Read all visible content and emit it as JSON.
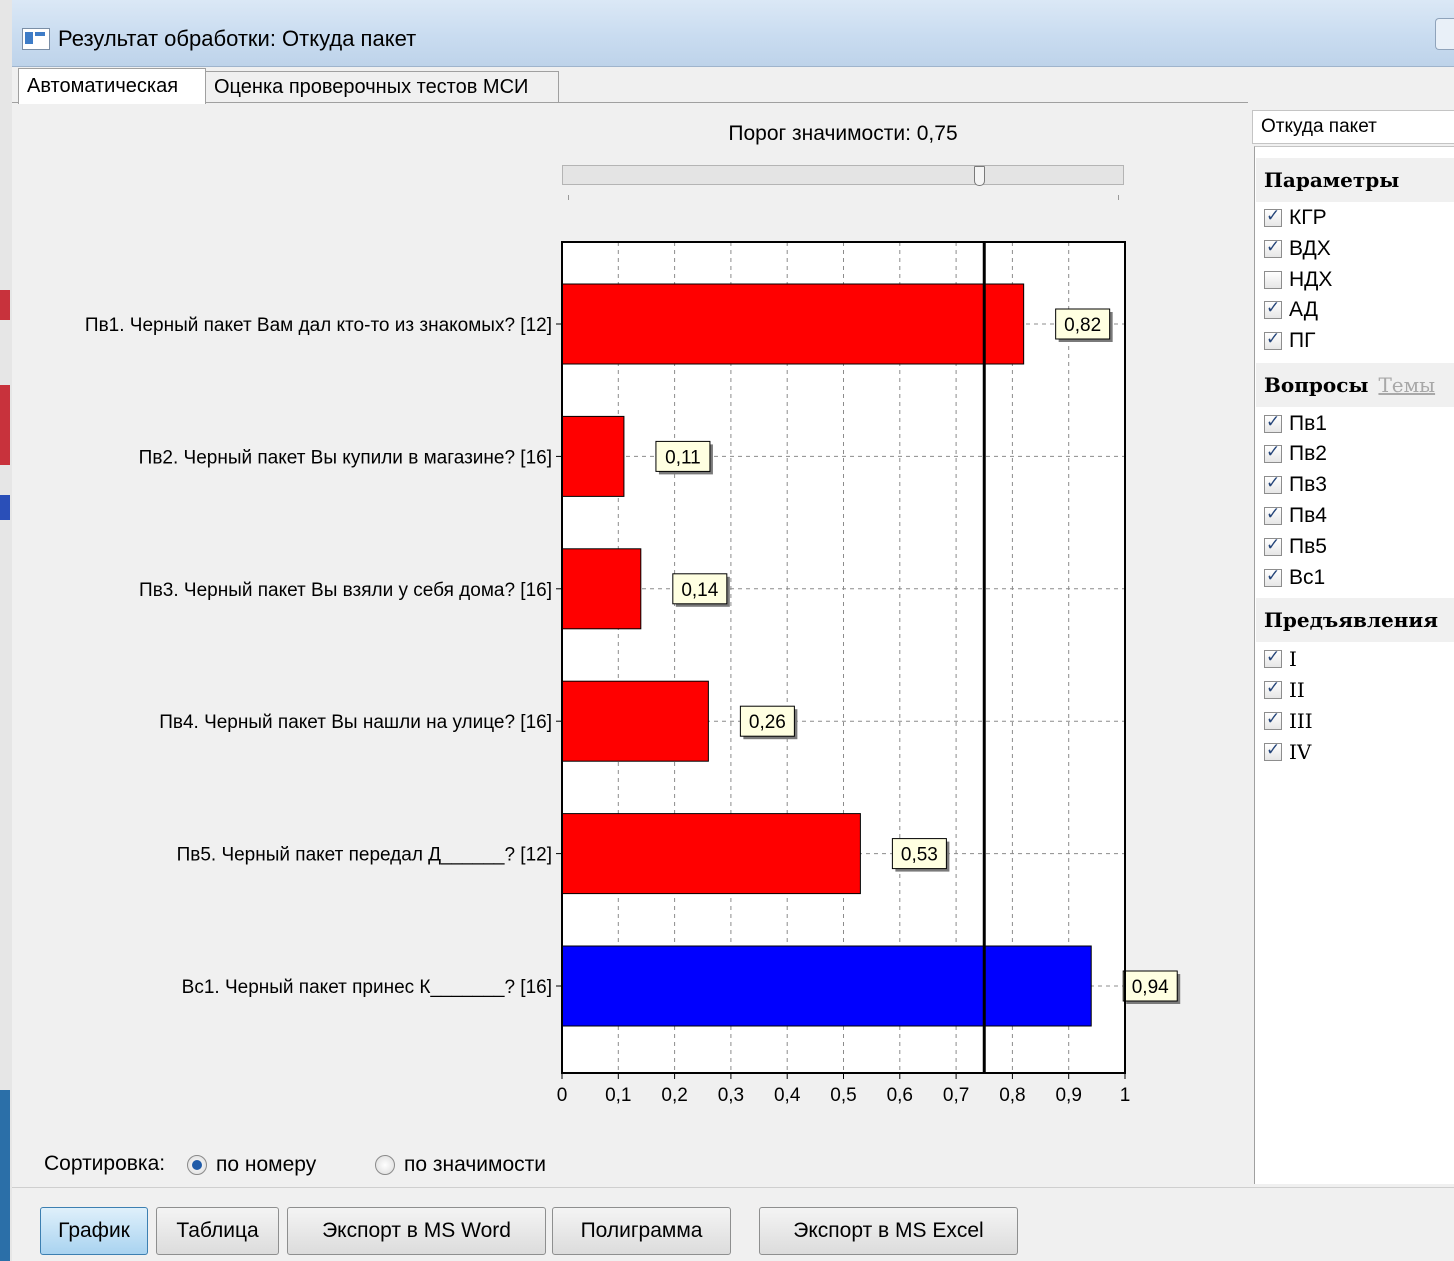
{
  "window": {
    "title": "Результат обработки: Откуда пакет"
  },
  "tabs": [
    {
      "label": "Автоматическая",
      "active": true
    },
    {
      "label": "Оценка проверочных тестов МСИ",
      "active": false
    }
  ],
  "threshold": {
    "label": "Порог значимости: 0,75",
    "value": 0.75
  },
  "chart_data": {
    "type": "bar",
    "orientation": "horizontal",
    "categories": [
      "Пв1. Черный пакет Вам дал кто-то из знакомых? [12]",
      "Пв2. Черный пакет Вы купили в магазине? [16]",
      "Пв3. Черный пакет Вы взяли у себя дома? [16]",
      "Пв4. Черный пакет Вы нашли на улице? [16]",
      "Пв5. Черный пакет передал Д______? [12]",
      "Вс1. Черный пакет принес К_______? [16]"
    ],
    "values": [
      0.82,
      0.11,
      0.14,
      0.26,
      0.53,
      0.94
    ],
    "value_labels": [
      "0,82",
      "0,11",
      "0,14",
      "0,26",
      "0,53",
      "0,94"
    ],
    "colors": [
      "#ff0000",
      "#ff0000",
      "#ff0000",
      "#ff0000",
      "#ff0000",
      "#0000ff"
    ],
    "xlim": [
      0,
      1
    ],
    "xticks": [
      0,
      0.1,
      0.2,
      0.3,
      0.4,
      0.5,
      0.6,
      0.7,
      0.8,
      0.9,
      1
    ],
    "xtick_labels": [
      "0",
      "0,1",
      "0,2",
      "0,3",
      "0,4",
      "0,5",
      "0,6",
      "0,7",
      "0,8",
      "0,9",
      "1"
    ],
    "threshold_line": 0.75,
    "grid": true
  },
  "sorting": {
    "label": "Сортировка:",
    "options": [
      "по номеру",
      "по значимости"
    ],
    "selected": "по номеру"
  },
  "buttons": {
    "graph": "График",
    "table": "Таблица",
    "export_word": "Экспорт в MS Word",
    "polygram": "Полиграмма",
    "export_excel": "Экспорт в MS Excel"
  },
  "right_panel": {
    "test_name": "Откуда пакет",
    "params_title": "Параметры",
    "params": [
      {
        "label": "КГР",
        "checked": true
      },
      {
        "label": "ВДХ",
        "checked": true
      },
      {
        "label": "НДХ",
        "checked": false
      },
      {
        "label": "АД",
        "checked": true
      },
      {
        "label": "ПГ",
        "checked": true
      }
    ],
    "questions_title": "Вопросы",
    "topics_link": "Темы",
    "questions": [
      {
        "label": "Пв1",
        "checked": true
      },
      {
        "label": "Пв2",
        "checked": true
      },
      {
        "label": "Пв3",
        "checked": true
      },
      {
        "label": "Пв4",
        "checked": true
      },
      {
        "label": "Пв5",
        "checked": true
      },
      {
        "label": "Вс1",
        "checked": true
      }
    ],
    "presentations_title": "Предъявления",
    "presentations": [
      {
        "label": "I",
        "checked": true
      },
      {
        "label": "II",
        "checked": true
      },
      {
        "label": "III",
        "checked": true
      },
      {
        "label": "IV",
        "checked": true
      }
    ]
  }
}
